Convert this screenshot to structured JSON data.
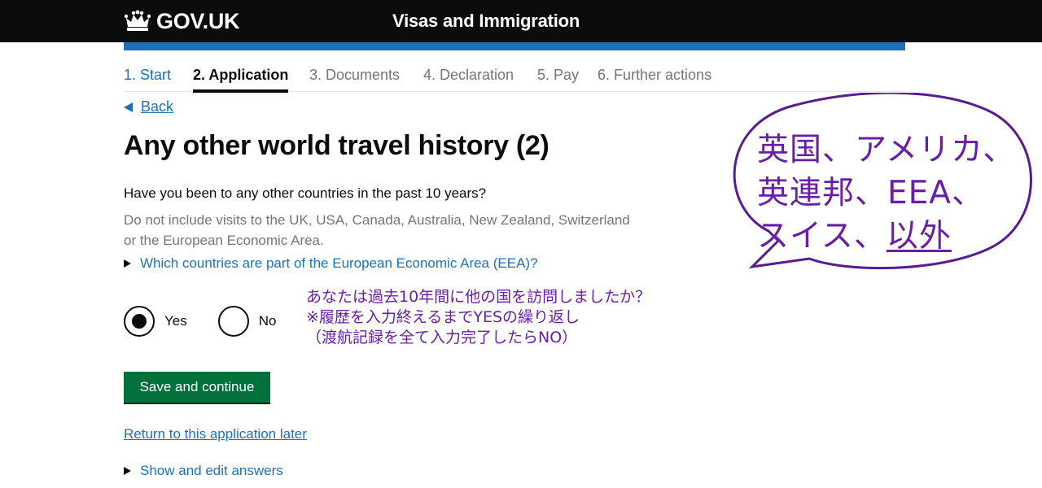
{
  "header": {
    "logo_text": "GOV.UK",
    "service_name": "Visas and Immigration",
    "logo_icon": "crown-icon"
  },
  "steps": [
    {
      "label": "1. Start",
      "state": "done"
    },
    {
      "label": "2. Application",
      "state": "current"
    },
    {
      "label": "3. Documents",
      "state": "future"
    },
    {
      "label": "4. Declaration",
      "state": "future"
    },
    {
      "label": "5. Pay",
      "state": "future"
    },
    {
      "label": "6. Further actions",
      "state": "future"
    }
  ],
  "back": {
    "label": "Back"
  },
  "page_title": "Any other world travel history (2)",
  "question": "Have you been to any other countries in the past 10 years?",
  "hint_line1": "Do not include visits to the UK, USA, Canada, Australia, New Zealand, Switzerland",
  "hint_line2": "or the European Economic Area.",
  "details_link": "Which countries are part of the European Economic Area (EEA)?",
  "radios": [
    {
      "label": "Yes",
      "checked": true
    },
    {
      "label": "No",
      "checked": false
    }
  ],
  "note": {
    "line1": "あなたは過去10年間に他の国を訪問しましたか？",
    "line2": "※履歴を入力終えるまでYESの繰り返し",
    "line3": "（渡航記録を全て入力完了したらNO）"
  },
  "bubble": {
    "line1": "英国、アメリカ、",
    "line2": "英連邦、EEA、",
    "line3_prefix": "スイス、",
    "line3_underlined": "以外"
  },
  "save_button": "Save and continue",
  "return_link": "Return to this application later",
  "show_answers": "Show and edit answers",
  "colors": {
    "header_bg": "#0b0c0c",
    "accent_blue": "#1d70b8",
    "button_green": "#00703c",
    "annotation_purple": "#6a1ea8"
  }
}
